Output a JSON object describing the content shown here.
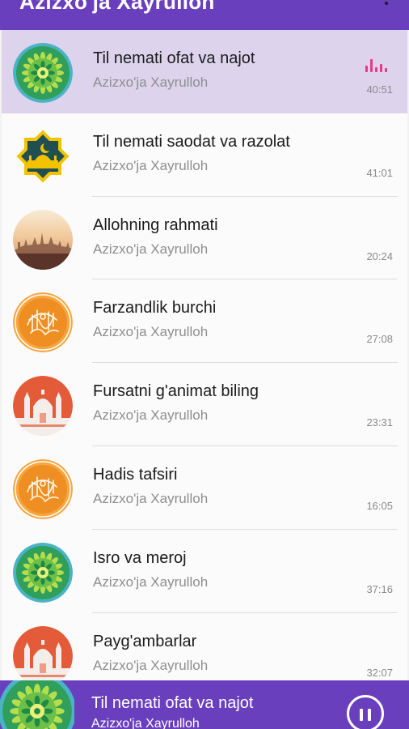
{
  "appbar": {
    "title": "Azizxo'ja Xayrulloh",
    "menu_icon": "more-vert-icon"
  },
  "tracks": [
    {
      "title": "Til nemati ofat va najot",
      "artist": "Azizxo'ja Xayrulloh",
      "duration": "40:51",
      "cover": "green-ornament-icon",
      "playing": true
    },
    {
      "title": "Til nemati saodat va razolat",
      "artist": "Azizxo'ja Xayrulloh",
      "duration": "41:01",
      "cover": "mosque-star-icon",
      "playing": false
    },
    {
      "title": "Allohning rahmati",
      "artist": "Azizxo'ja Xayrulloh",
      "duration": "20:24",
      "cover": "city-sunset-icon",
      "playing": false
    },
    {
      "title": "Farzandlik burchi",
      "artist": "Azizxo'ja Xayrulloh",
      "duration": "27:08",
      "cover": "orange-calligraphy-icon",
      "playing": false
    },
    {
      "title": "Fursatni g'animat biling",
      "artist": "Azizxo'ja Xayrulloh",
      "duration": "23:31",
      "cover": "red-mosque-icon",
      "playing": false
    },
    {
      "title": "Hadis tafsiri",
      "artist": "Azizxo'ja Xayrulloh",
      "duration": "16:05",
      "cover": "orange-calligraphy-icon",
      "playing": false
    },
    {
      "title": "Isro va meroj",
      "artist": "Azizxo'ja Xayrulloh",
      "duration": "37:16",
      "cover": "green-ornament-icon",
      "playing": false
    },
    {
      "title": "Payg'ambarlar",
      "artist": "Azizxo'ja Xayrulloh",
      "duration": "32:07",
      "cover": "red-mosque-icon",
      "playing": false
    }
  ],
  "player": {
    "title": "Til nemati ofat va najot",
    "artist": "Azizxo'ja Xayrulloh",
    "button_icon": "pause-icon"
  },
  "colors": {
    "primary": "#6a3fbe",
    "selected_row": "#ddd3ed",
    "equalizer": "#e5398c"
  }
}
